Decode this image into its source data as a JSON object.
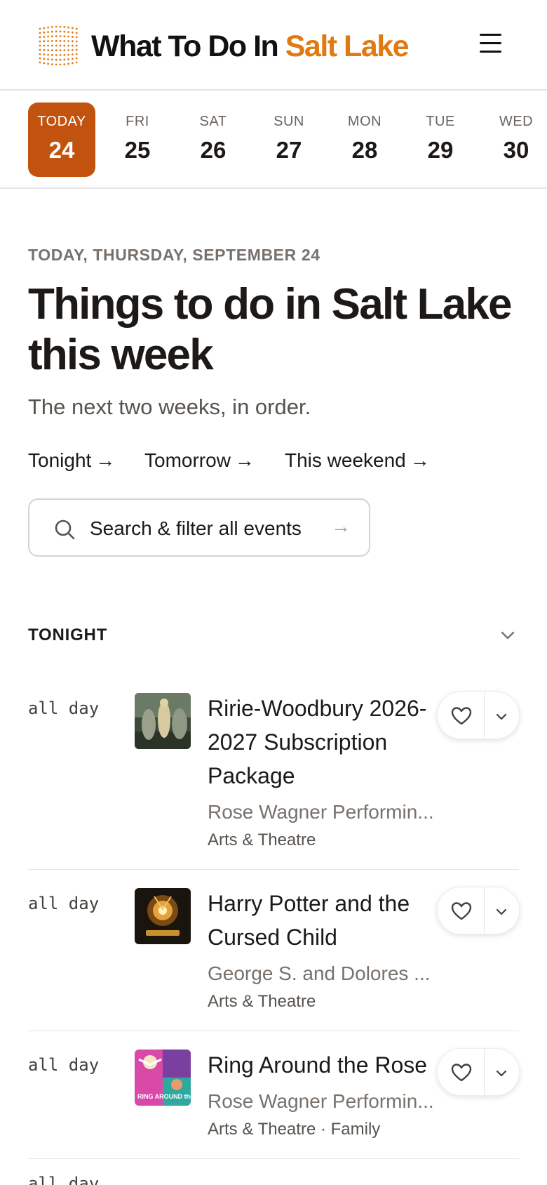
{
  "header": {
    "brand_part1": "What To Do In ",
    "brand_part2": "Salt Lake",
    "logo_icon": "grid-logo-icon",
    "menu_icon": "hamburger-menu-icon",
    "accent_color": "#e07a12"
  },
  "days": [
    {
      "name": "TODAY",
      "date": "24",
      "active": true
    },
    {
      "name": "FRI",
      "date": "25"
    },
    {
      "name": "SAT",
      "date": "26"
    },
    {
      "name": "SUN",
      "date": "27"
    },
    {
      "name": "MON",
      "date": "28"
    },
    {
      "name": "TUE",
      "date": "29"
    },
    {
      "name": "WED",
      "date": "30"
    }
  ],
  "active_day_color": "#c2530f",
  "intro": {
    "dateline": "TODAY, THURSDAY, SEPTEMBER 24",
    "title": "Things to do in Salt Lake this week",
    "subtitle": "The next two weeks, in order.",
    "links": [
      {
        "label": "Tonight",
        "arrow": "→"
      },
      {
        "label": "Tomorrow",
        "arrow": "→"
      },
      {
        "label": "This weekend",
        "arrow": "→"
      }
    ]
  },
  "search": {
    "label": "Search & filter all events",
    "arrow": "→",
    "icon": "search-icon"
  },
  "section": {
    "label": "TONIGHT",
    "icon": "chevron-down-icon"
  },
  "events": [
    {
      "time": "all day",
      "title": "Ririe-Woodbury 2026-2027 Subscription Package",
      "venue": "Rose Wagner Performin...",
      "category": "Arts & Theatre"
    },
    {
      "time": "all day",
      "title": "Harry Potter and the Cursed Child",
      "venue": "George S. and Dolores ...",
      "category": "Arts & Theatre"
    },
    {
      "time": "all day",
      "title": "Ring Around the Rose",
      "venue": "Rose Wagner Performin...",
      "category": "Arts & Theatre · Family",
      "thumb_text": "RING AROUND the ROSE"
    }
  ],
  "partial_next_time": "all day"
}
